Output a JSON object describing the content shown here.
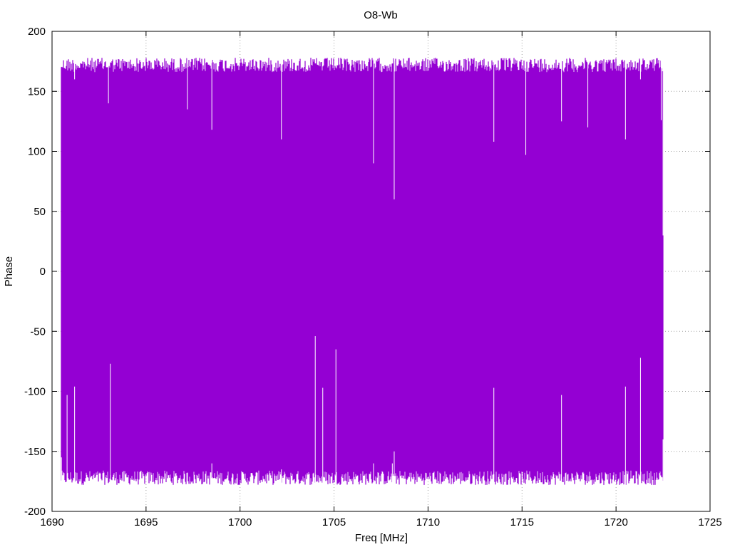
{
  "chart_data": {
    "type": "line",
    "title": "O8-Wb",
    "xlabel": "Freq [MHz]",
    "ylabel": "Phase",
    "xlim": [
      1690,
      1725
    ],
    "ylim": [
      -200,
      200
    ],
    "xticks": [
      1690,
      1695,
      1700,
      1705,
      1710,
      1715,
      1720,
      1725
    ],
    "yticks": [
      -200,
      -150,
      -100,
      -50,
      0,
      50,
      100,
      150,
      200
    ],
    "grid": true,
    "legend": "none",
    "series": [
      {
        "color": "#9400d3",
        "x_range": [
          1690.5,
          1722.5
        ],
        "y_range_typical": [
          -178,
          178
        ],
        "x": [
          1690.5,
          1690.6,
          1690.8,
          1691.2,
          1693.0,
          1693.1,
          1697.2,
          1698.5,
          1702.2,
          1704.0,
          1704.4,
          1705.1,
          1707.1,
          1708.1,
          1708.2,
          1710.0,
          1713.5,
          1715.2,
          1717.1,
          1718.5,
          1720.5,
          1721.3,
          1722.4,
          1722.5
        ],
        "y_max": [
          178,
          176,
          174,
          160,
          140,
          172,
          135,
          118,
          110,
          172,
          168,
          170,
          90,
          172,
          60,
          168,
          108,
          97,
          125,
          120,
          110,
          160,
          126,
          30
        ],
        "y_min": [
          -155,
          -178,
          -103,
          -96,
          -178,
          -77,
          -170,
          -160,
          -165,
          -54,
          -97,
          -65,
          -160,
          -160,
          -150,
          -170,
          -97,
          -170,
          -103,
          -170,
          -96,
          -72,
          -178,
          -140
        ]
      }
    ]
  }
}
